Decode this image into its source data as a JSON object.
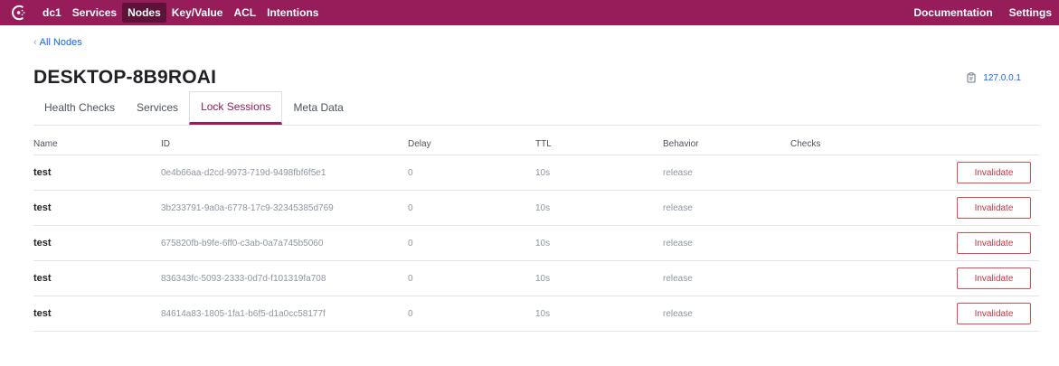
{
  "nav": {
    "logo_icon": "consul-logo-icon",
    "left": [
      "dc1",
      "Services",
      "Nodes",
      "Key/Value",
      "ACL",
      "Intentions"
    ],
    "active": "Nodes",
    "right": [
      "Documentation",
      "Settings"
    ]
  },
  "breadcrumb": {
    "label": "All Nodes"
  },
  "title": "DESKTOP-8B9ROAI",
  "address": {
    "icon": "clipboard-icon",
    "value": "127.0.0.1"
  },
  "tabs": [
    "Health Checks",
    "Services",
    "Lock Sessions",
    "Meta Data"
  ],
  "active_tab": "Lock Sessions",
  "table": {
    "headers": [
      "Name",
      "ID",
      "Delay",
      "TTL",
      "Behavior",
      "Checks"
    ],
    "rows": [
      {
        "name": "test",
        "id": "0e4b66aa-d2cd-9973-719d-9498fbf6f5e1",
        "delay": "0",
        "ttl": "10s",
        "behavior": "release",
        "action": "Invalidate"
      },
      {
        "name": "test",
        "id": "3b233791-9a0a-6778-17c9-32345385d769",
        "delay": "0",
        "ttl": "10s",
        "behavior": "release",
        "action": "Invalidate"
      },
      {
        "name": "test",
        "id": "675820fb-b9fe-6ff0-c3ab-0a7a745b5060",
        "delay": "0",
        "ttl": "10s",
        "behavior": "release",
        "action": "Invalidate"
      },
      {
        "name": "test",
        "id": "836343fc-5093-2333-0d7d-f101319fa708",
        "delay": "0",
        "ttl": "10s",
        "behavior": "release",
        "action": "Invalidate"
      },
      {
        "name": "test",
        "id": "84614a83-1805-1fa1-b6f5-d1a0cc58177f",
        "delay": "0",
        "ttl": "10s",
        "behavior": "release",
        "action": "Invalidate"
      }
    ]
  },
  "colors": {
    "brand": "#961d59",
    "brand_dark": "#5d1237",
    "link": "#1563ff",
    "danger": "#c73445"
  }
}
